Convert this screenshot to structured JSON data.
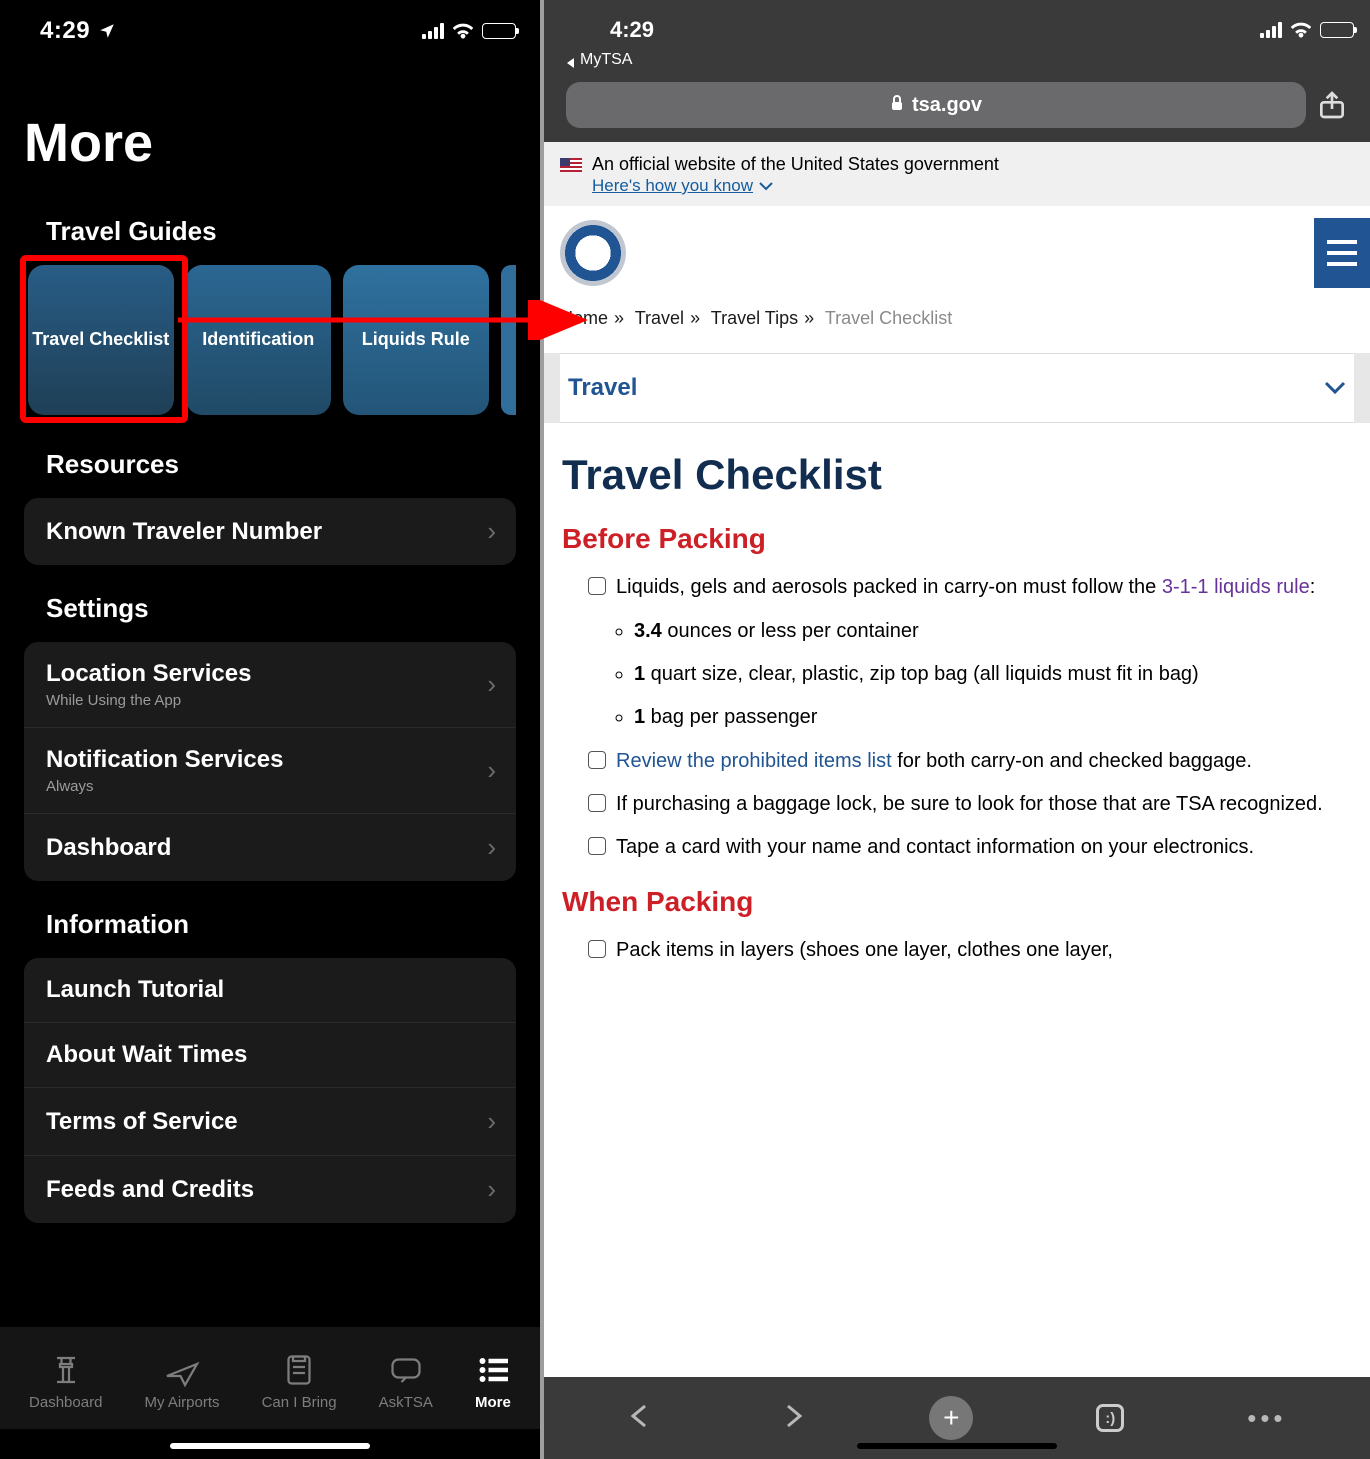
{
  "status": {
    "time": "4:29"
  },
  "left": {
    "title": "More",
    "sections": {
      "travel_guides": "Travel Guides",
      "resources": "Resources",
      "settings": "Settings",
      "information": "Information"
    },
    "guides": [
      {
        "label": "Travel Checklist"
      },
      {
        "label": "Identification"
      },
      {
        "label": "Liquids Rule"
      }
    ],
    "resources": [
      {
        "label": "Known Traveler Number",
        "chevron": true
      }
    ],
    "settings": [
      {
        "label": "Location Services",
        "sub": "While Using the App",
        "chevron": true
      },
      {
        "label": "Notification Services",
        "sub": "Always",
        "chevron": true
      },
      {
        "label": "Dashboard",
        "chevron": true
      }
    ],
    "information": [
      {
        "label": "Launch Tutorial",
        "chevron": false
      },
      {
        "label": "About Wait Times",
        "chevron": false
      },
      {
        "label": "Terms of Service",
        "chevron": true
      },
      {
        "label": "Feeds and Credits",
        "chevron": true
      }
    ],
    "tabs": [
      {
        "label": "Dashboard"
      },
      {
        "label": "My Airports"
      },
      {
        "label": "Can I Bring"
      },
      {
        "label": "AskTSA"
      },
      {
        "label": "More"
      }
    ]
  },
  "right": {
    "back_app": "MyTSA",
    "address": "tsa.gov",
    "gov_banner": {
      "line1": "An official website of the United States government",
      "line2": "Here's how you know"
    },
    "breadcrumbs": {
      "home": "Home",
      "travel": "Travel",
      "tips": "Travel Tips",
      "current": "Travel Checklist"
    },
    "dropdown": "Travel",
    "page_h1": "Travel Checklist",
    "before_h": "Before Packing",
    "liquids_intro_a": "Liquids, gels and aerosols packed in carry-on must follow the ",
    "liquids_link": "3-1-1 liquids rule",
    "liquids_intro_b": ":",
    "rules": {
      "r1a": "3.4",
      "r1b": " ounces or less per container",
      "r2a": "1",
      "r2b": " quart size, clear, plastic, zip top bag (all liquids must fit in bag)",
      "r3a": "1",
      "r3b": " bag per passenger"
    },
    "item2_link": "Review the prohibited items list",
    "item2_rest": " for both carry-on and checked baggage.",
    "item3": "If purchasing a baggage lock, be sure to look for those that are TSA recognized.",
    "item4": "Tape a card with your name and contact information on your electronics.",
    "when_h": "When Packing",
    "item5": "Pack items in layers (shoes one layer, clothes one layer,"
  }
}
